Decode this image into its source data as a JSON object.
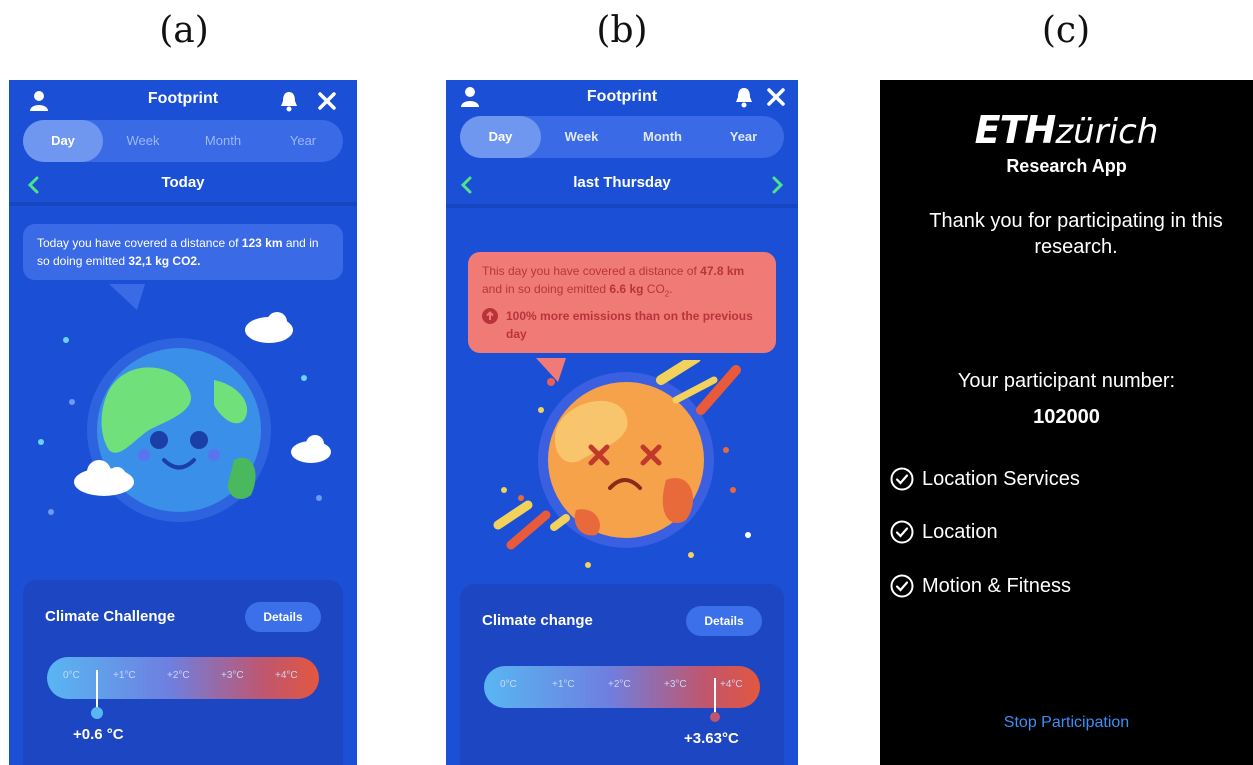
{
  "labels": {
    "a": "(a)",
    "b": "(b)",
    "c": "(c)"
  },
  "panel_a": {
    "title": "Footprint",
    "tabs": [
      "Day",
      "Week",
      "Month",
      "Year"
    ],
    "active_tab": "Day",
    "nav_title": "Today",
    "bubble_pre": "Today you have covered a distance of ",
    "bubble_distance": "123 km",
    "bubble_mid": " and in so doing emitted ",
    "bubble_emission": "32,1 kg CO2.",
    "card_title": "Climate Challenge",
    "details": "Details",
    "scale_ticks": [
      "0°C",
      "+1°C",
      "+2°C",
      "+3°C",
      "+4°C"
    ],
    "temperature": "+0.6 °C",
    "temperature_value": 0.6,
    "bubble_color": "#3a6ae6"
  },
  "panel_b": {
    "title": "Footprint",
    "tabs": [
      "Day",
      "Week",
      "Month",
      "Year"
    ],
    "active_tab": "Day",
    "nav_title": "last Thursday",
    "bubble_pre": "This day you have covered a distance of ",
    "bubble_distance": "47.8 km",
    "bubble_mid": " and in so doing emitted ",
    "bubble_emission": "6.6 kg",
    "bubble_unit": " CO",
    "bubble_sub": "2",
    "bubble_dot": ".",
    "bubble_warning": "100% more emissions than on the previous day",
    "card_title": "Climate change",
    "details": "Details",
    "scale_ticks": [
      "0°C",
      "+1°C",
      "+2°C",
      "+3°C",
      "+4°C"
    ],
    "temperature": "+3.63°C",
    "temperature_value": 3.63,
    "bubble_color": "#f07b76"
  },
  "panel_c": {
    "logo_eth": "ETH",
    "logo_zurich": "zürich",
    "app_name": "Research App",
    "thanks": "Thank you for participating in this research.",
    "participant_label": "Your participant number:",
    "participant_number": "102000",
    "permissions": [
      "Location Services",
      "Location",
      "Motion & Fitness"
    ],
    "stop": "Stop Participation",
    "link_color": "#3d8ef6"
  }
}
